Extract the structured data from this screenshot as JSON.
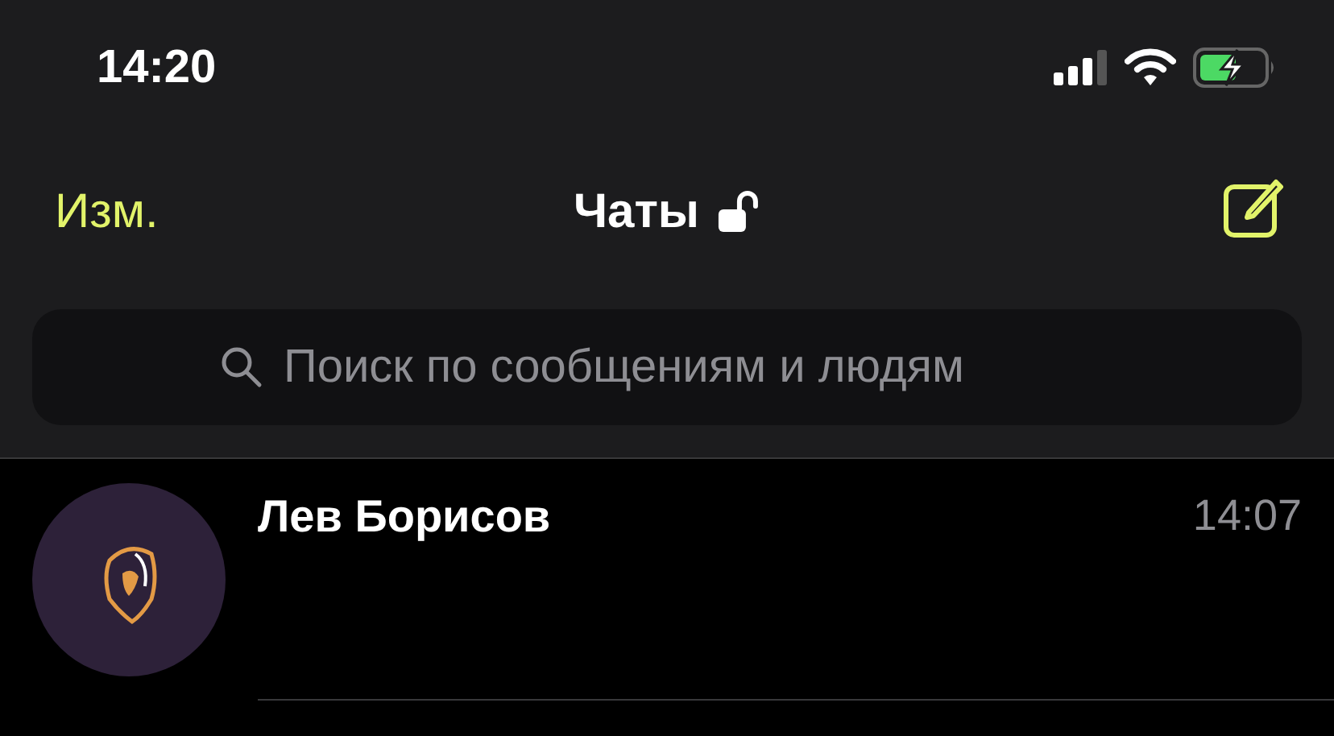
{
  "status_bar": {
    "time": "14:20"
  },
  "nav_bar": {
    "edit": "Изм.",
    "title": "Чаты"
  },
  "search": {
    "placeholder": "Поиск по сообщениям и людям"
  },
  "chats": [
    {
      "name": "Лев Борисов",
      "time": "14:07"
    }
  ]
}
